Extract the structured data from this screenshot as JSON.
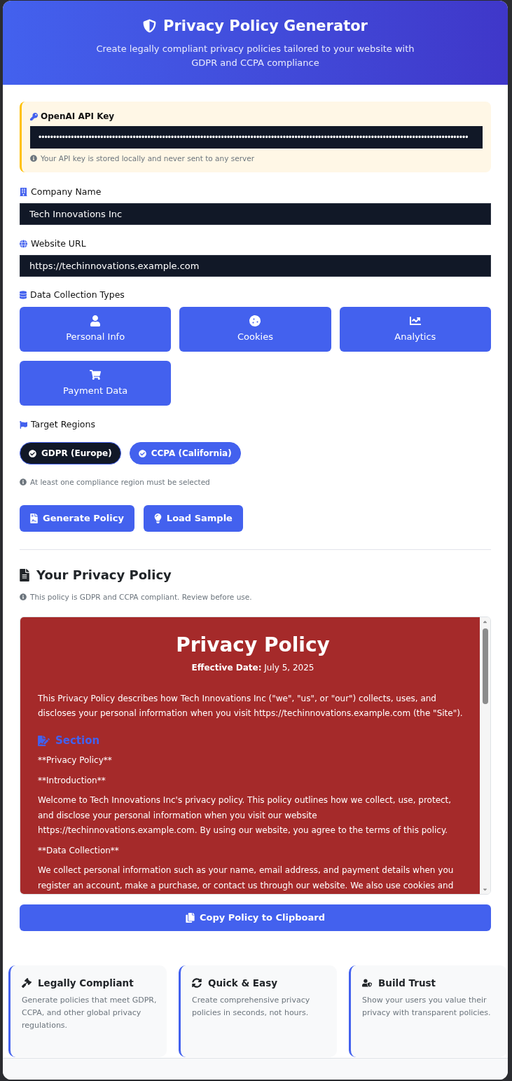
{
  "header": {
    "title": "Privacy Policy Generator",
    "subtitle": "Create legally compliant privacy policies tailored to your website with GDPR and CCPA compliance"
  },
  "api_key": {
    "label": "OpenAI API Key",
    "value": "••••••••••••••••••••••••••••••••••••••••••••••••••••••••••••••••••••••••••••••••••••••••••••••••••••••••••••••••••••••••••••••••••••••••••••••••••",
    "hint": "Your API key is stored locally and never sent to any server"
  },
  "fields": [
    {
      "label": "Company Name",
      "value": "Tech Innovations Inc"
    },
    {
      "label": "Website URL",
      "value": "https://techinnovations.example.com"
    }
  ],
  "data_types": {
    "label": "Data Collection Types",
    "options": [
      {
        "label": "Personal Info",
        "selected": true
      },
      {
        "label": "Cookies",
        "selected": true
      },
      {
        "label": "Analytics",
        "selected": true
      },
      {
        "label": "Payment Data",
        "selected": true
      }
    ]
  },
  "regions": {
    "label": "Target Regions",
    "options": [
      {
        "label": "GDPR (Europe)",
        "selected": true,
        "focused": true
      },
      {
        "label": "CCPA (California)",
        "selected": true,
        "focused": false
      }
    ],
    "hint": "At least one compliance region must be selected"
  },
  "actions": [
    "Generate Policy",
    "Load Sample"
  ],
  "result": {
    "title": "Your Privacy Policy",
    "note": "This policy is GDPR and CCPA compliant. Review before use.",
    "document": {
      "title": "Privacy Policy",
      "effective": "**Effective Date:** July 5, 2025",
      "intro": "This Privacy Policy describes how Tech Innovations Inc (\"we\", \"us\", or \"our\") collects, uses, and discloses your personal information when you visit https://techinnovations.example.com (the \"Site\").",
      "section_heading": "Section",
      "blocks": [
        "**Privacy Policy**",
        "**Introduction**",
        "Welcome to Tech Innovations Inc's privacy policy. This policy outlines how we collect, use, protect, and disclose your personal information when you visit our website https://techinnovations.example.com. By using our website, you agree to the terms of this policy.",
        "**Data Collection**",
        "We collect personal information such as your name, email address, and payment details when you register an account, make a purchase, or contact us through our website. We also use cookies and"
      ]
    },
    "copy_button": "Copy Policy to Clipboard"
  },
  "features": [
    {
      "title": "Legally Compliant",
      "text": "Generate policies that meet GDPR, CCPA, and other global privacy regulations."
    },
    {
      "title": "Quick & Easy",
      "text": "Create comprehensive privacy policies in seconds, not hours."
    },
    {
      "title": "Build Trust",
      "text": "Show your users you value their privacy with transparent policies."
    }
  ]
}
